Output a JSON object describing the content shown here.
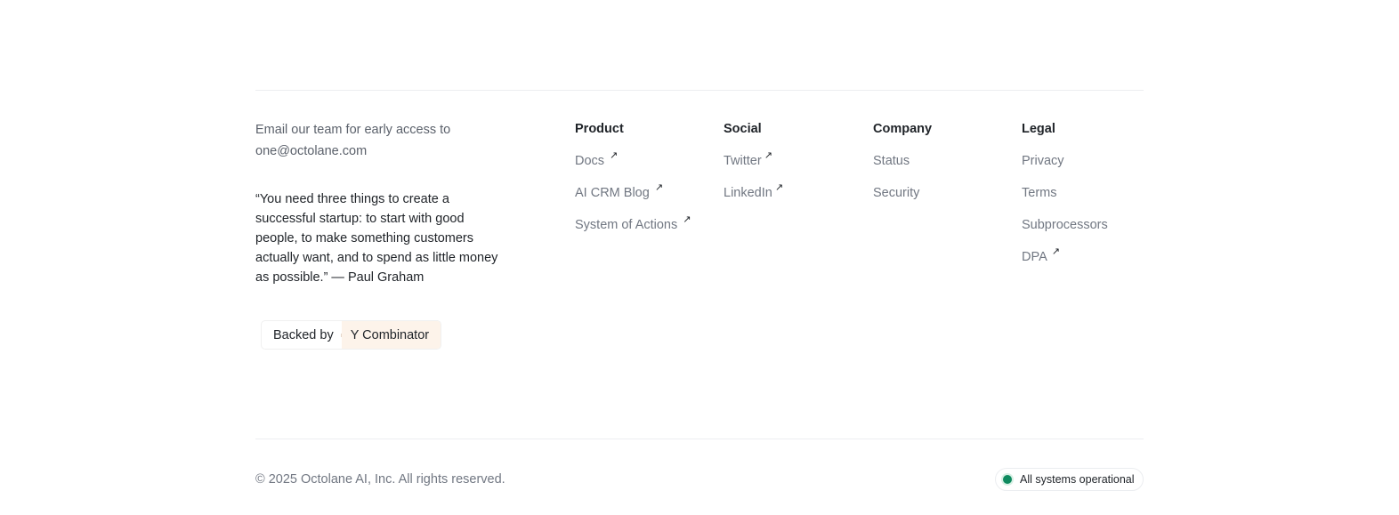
{
  "intro": {
    "line1": "Email our team for early access to",
    "email": "one@octolane.com",
    "quote": "“You need three things to create a successful startup: to start with good people, to make something customers actually want, and to spend as little money as possible.” — Paul Graham"
  },
  "badge": {
    "left": "Backed by",
    "right": "Y Combinator"
  },
  "columns": {
    "product": {
      "title": "Product",
      "items": [
        {
          "label": "Docs",
          "external": true
        },
        {
          "label": "AI CRM Blog",
          "external": true
        },
        {
          "label": "System of Actions",
          "external": true
        }
      ]
    },
    "social": {
      "title": "Social",
      "items": [
        {
          "label": "Twitter",
          "external": true
        },
        {
          "label": "LinkedIn",
          "external": true
        }
      ]
    },
    "company": {
      "title": "Company",
      "items": [
        {
          "label": "Status",
          "external": false
        },
        {
          "label": "Security",
          "external": false
        }
      ]
    },
    "legal": {
      "title": "Legal",
      "items": [
        {
          "label": "Privacy",
          "external": false
        },
        {
          "label": "Terms",
          "external": false
        },
        {
          "label": "Subprocessors",
          "external": false
        },
        {
          "label": "DPA",
          "external": true
        }
      ]
    }
  },
  "icons": {
    "external": "external-link-arrow-icon",
    "status": "status-dot-icon"
  },
  "colors": {
    "status_green": "#0f8a5f",
    "yc_tint": "#fdf3ea"
  },
  "footer": {
    "copyright": "© 2025 Octolane AI, Inc. All rights reserved.",
    "status": "All systems operational"
  }
}
